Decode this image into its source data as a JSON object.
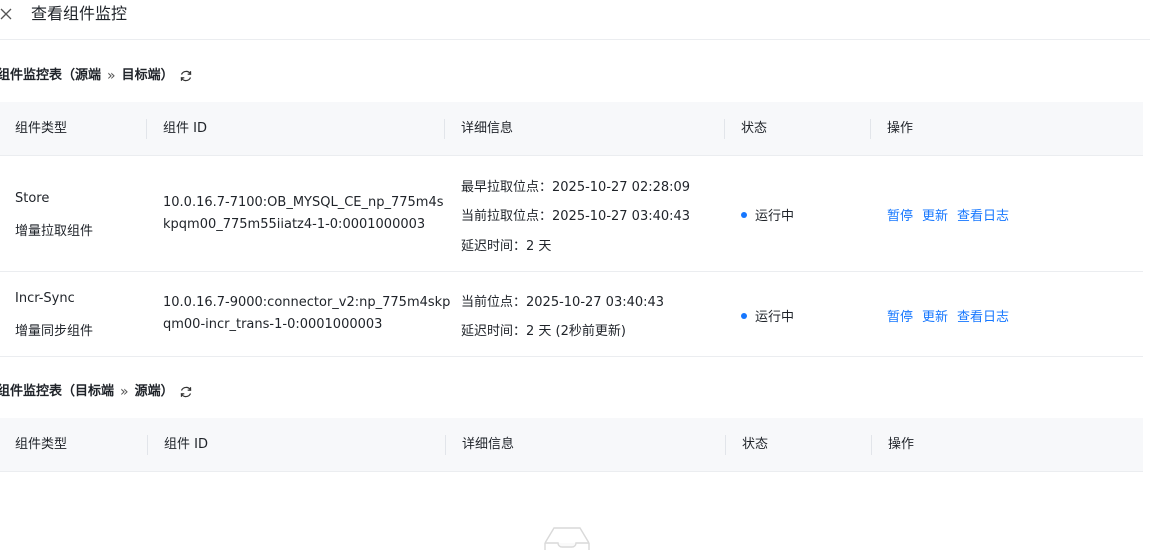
{
  "header": {
    "title": "查看组件监控"
  },
  "section1": {
    "title": "组件监控表（源端",
    "sep": "»",
    "title_end": "目标端）"
  },
  "section2": {
    "title": "组件监控表（目标端",
    "sep": "»",
    "title_end": "源端）"
  },
  "columns": [
    "组件类型",
    "组件 ID",
    "详细信息",
    "状态",
    "操作"
  ],
  "rows": [
    {
      "type_name": "Store",
      "type_desc": "增量拉取组件",
      "id_line1": "10.0.16.7-7100:OB_MYSQL_CE_np_775m4s",
      "id_line2": "kpqm00_775m55iiatz4-1-0:0001000003",
      "detail1": "最早拉取位点：2025-10-27 02:28:09",
      "detail2": "当前拉取位点：2025-10-27 03:40:43",
      "detail3": "延迟时间：2 天",
      "status": "运行中",
      "ops": [
        "暂停",
        "更新",
        "查看日志"
      ]
    },
    {
      "type_name": "Incr-Sync",
      "type_desc": "增量同步组件",
      "id_line1": "10.0.16.7-9000:connector_v2:np_775m4skp",
      "id_line2": "qm00-incr_trans-1-0:0001000003",
      "detail1": "当前位点：2025-10-27 03:40:43",
      "detail2": "延迟时间：2 天 (2秒前更新)",
      "status": "运行中",
      "ops": [
        "暂停",
        "更新",
        "查看日志"
      ]
    }
  ],
  "icons": {
    "close": "close-icon",
    "refresh": "refresh-icon",
    "empty": "empty-inbox-icon"
  },
  "colors": {
    "link": "#1677ff",
    "status_dot": "#1677ff",
    "header_bg": "#f7f8fa"
  }
}
